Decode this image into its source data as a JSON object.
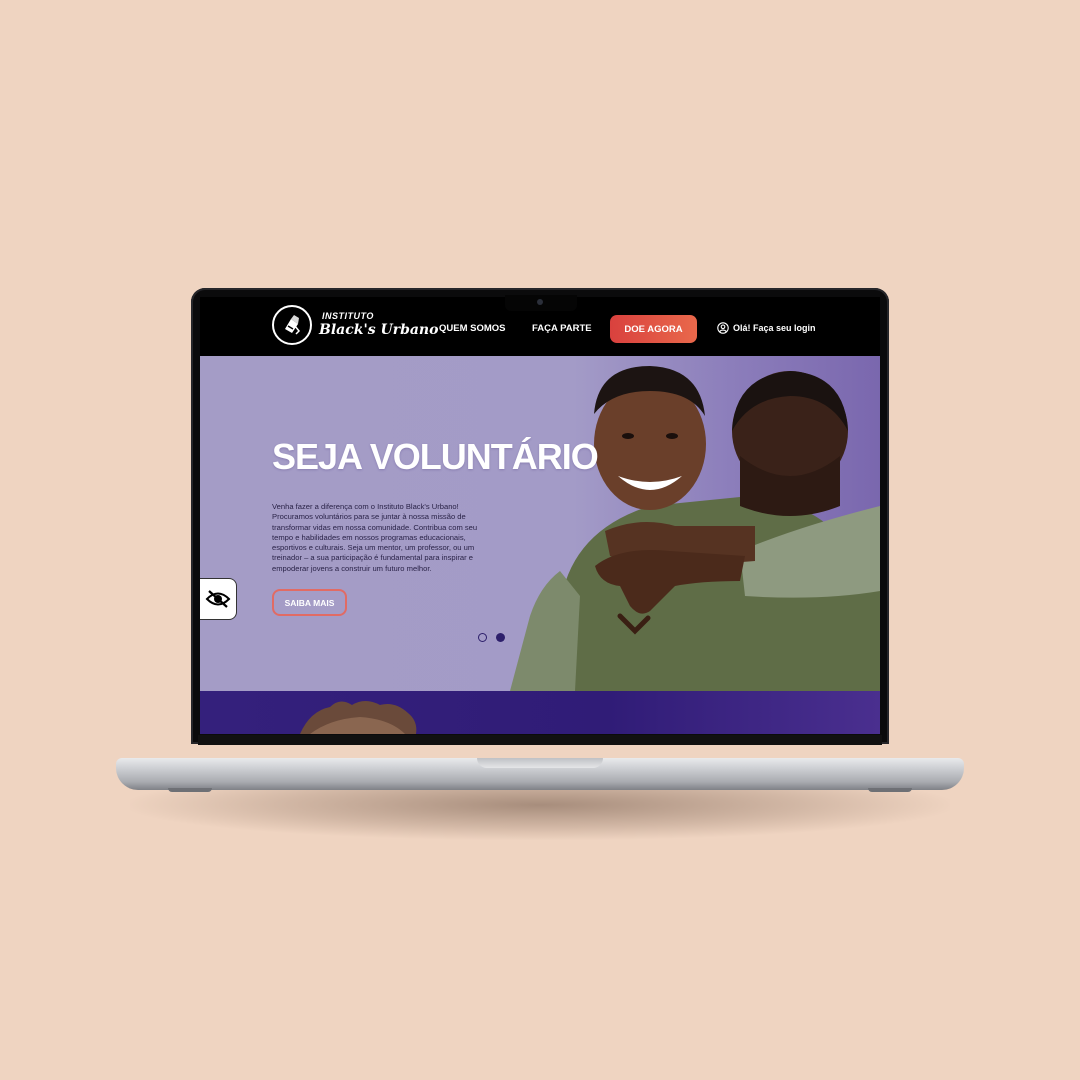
{
  "brand": {
    "line1": "INSTITUTO",
    "line2": "Black's Urbano"
  },
  "nav": {
    "items": [
      {
        "label": "QUEM SOMOS"
      },
      {
        "label": "FAÇA PARTE"
      }
    ],
    "donate_label": "DOE AGORA",
    "login_label": "Olá! Faça seu login"
  },
  "hero": {
    "title": "SEJA VOLUNTÁRIO",
    "text": "Venha fazer a diferença com o Instituto Black's Urbano! Procuramos voluntários para se juntar à nossa missão de transformar vidas em nossa comunidade. Contribua com seu tempo e habilidades em nossos programas educacionais, esportivos e culturais. Seja um mentor, um professor, ou um treinador – a sua participação é fundamental para inspirar e empoderar jovens a construir um futuro melhor.",
    "button_label": "SAIBA MAIS",
    "carousel": {
      "slides": 2,
      "active": 2
    }
  },
  "colors": {
    "background": "#efd4c1",
    "hero_bg": "#a39bc7",
    "accent": "#e1544a",
    "section_purple": "#34207c",
    "dot": "#2d1f6b"
  },
  "icons": {
    "logo": "logo-emblem-icon",
    "login": "user-circle-icon",
    "accessibility": "eye-slash-icon"
  }
}
